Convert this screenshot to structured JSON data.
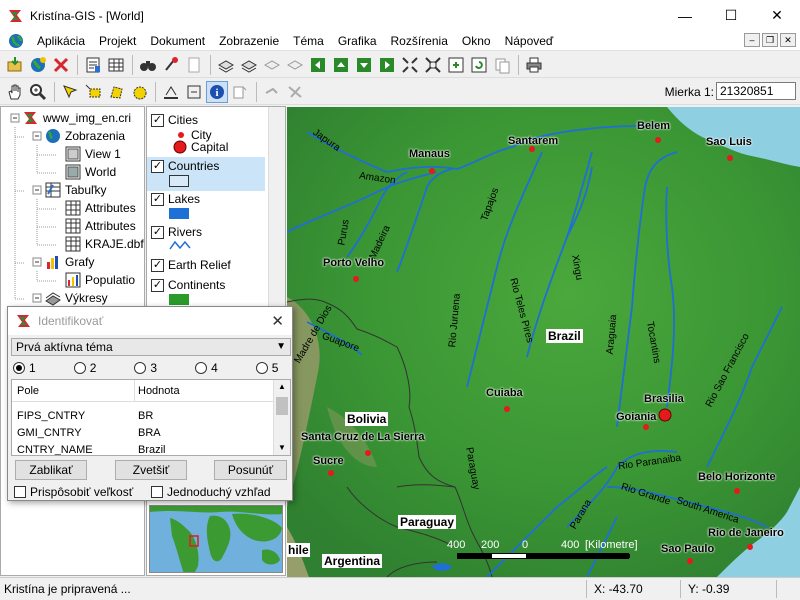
{
  "window": {
    "title": "Kristína-GIS - [World]"
  },
  "menu": [
    "Aplikácia",
    "Projekt",
    "Dokument",
    "Zobrazenie",
    "Téma",
    "Grafika",
    "Rozšírenia",
    "Okno",
    "Nápoveď"
  ],
  "scale": {
    "label": "Mierka 1:",
    "value": "21320851"
  },
  "tree": {
    "root": "www_img_en.cri",
    "views_group": "Zobrazenia",
    "view1": "View 1",
    "world": "World",
    "tables_group": "Tabuľky",
    "attr1": "Attributes",
    "attr2": "Attributes",
    "kraje": "KRAJE.dbf",
    "charts_group": "Grafy",
    "popul": "Populatio",
    "layouts_group": "Výkresy"
  },
  "legend": {
    "cities": "Cities",
    "city": "City",
    "capital": "Capital",
    "countries": "Countries",
    "lakes": "Lakes",
    "rivers": "Rivers",
    "relief": "Earth Relief",
    "continents": "Continents"
  },
  "map": {
    "cities": [
      "Manaus",
      "Santarem",
      "Belem",
      "Sao Luis",
      "Porto Velho",
      "Cuiaba",
      "Brasilia",
      "Goiania",
      "Belo Horizonte",
      "Rio de Janeiro",
      "Sao Paulo",
      "Sucre",
      "Santa Cruz de La Sierra"
    ],
    "countries": [
      "Brazil",
      "Bolivia",
      "Paraguay",
      "Argentina"
    ],
    "edge_label": "hile",
    "rivers": [
      "Japura",
      "Amazon",
      "Purus",
      "Madeira",
      "Tapajos",
      "Xingu",
      "Rio Juruena",
      "Rio Teles Pires",
      "Araguaia",
      "Tocantins",
      "Rio Sao Francisco",
      "Guapore",
      "Madre de Dios",
      "Paraguay",
      "Rio Paranaiba",
      "Rio Grande",
      "South America",
      "Parana"
    ],
    "scalebar": {
      "t0": "400",
      "t1": "200",
      "t2": "0",
      "t3": "400",
      "unit": "[Kilometre]"
    }
  },
  "dialog": {
    "title": "Identifikovať",
    "select": "Prvá aktívna téma",
    "radios": [
      "1",
      "2",
      "3",
      "4",
      "5"
    ],
    "col_field": "Pole",
    "col_value": "Hodnota",
    "rows": [
      {
        "field": "FIPS_CNTRY",
        "value": "BR"
      },
      {
        "field": "GMI_CNTRY",
        "value": "BRA"
      },
      {
        "field": "CNTRY_NAME",
        "value": "Brazil"
      }
    ],
    "btn_blink": "Zablikať",
    "btn_zoom": "Zvetšiť",
    "btn_pan": "Posunúť",
    "chk_fit": "Prispôsobiť veľkosť",
    "chk_simple": "Jednoduchý vzhľad"
  },
  "status": {
    "message": "Kristína je pripravená ...",
    "x": "X: -43.70",
    "y": "Y: -0.39"
  },
  "colors": {
    "land": "#3e9b35",
    "water": "#1e6fd6",
    "city": "#e41a1c"
  }
}
